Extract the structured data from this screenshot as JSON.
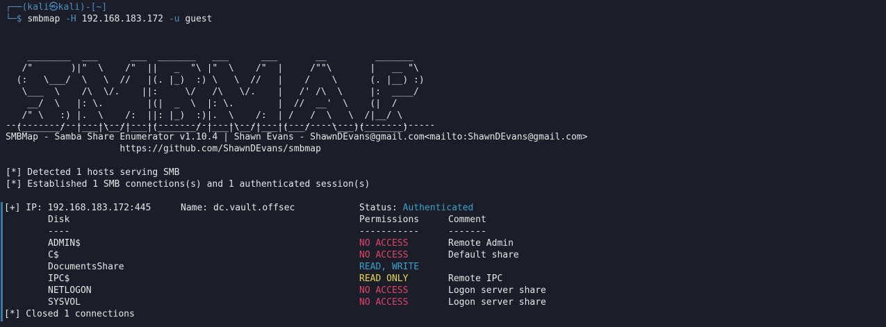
{
  "prompt": {
    "line1": "┌──(kali㉿kali)-[~]",
    "line2_prefix": "└─$ ",
    "command": "smbmap",
    "flag_h": "-H",
    "host": "192.168.183.172",
    "flag_u": "-u",
    "user": "guest"
  },
  "banner": [
    "    ________  ___      ___  _______   ___      ___       __         _______",
    "   /\"       )|\"  \\    /\"  ||   _  \"\\ |\"  \\    /\"  |     /\"\"\\       |   __ \"\\",
    "  (:   \\___/  \\   \\  //   |(. |_)  :) \\   \\  //   |    /    \\      (. |__) :)",
    "   \\___  \\    /\\  \\/.    ||:     \\/   /\\   \\/.    |   /' /\\  \\     |:  ____/",
    "    __/  \\   |: \\.        |(|  _  \\  |: \\.        |  //  __'  \\    (|  /",
    "   /\" \\   :) |.  \\    /:  ||: |_)  :)|.  \\    /:  | /   /  \\   \\  /|__/ \\",
    "  (_______/  |___|\\__/|___|(_______/ |___|\\__/|___|(___/    \\___)(_______)"
  ],
  "rule": "-------------------------------------------------------------------------------",
  "credit_line": "SMBMap - Samba Share Enumerator v1.10.4 | Shawn Evans - ShawnDEvans@gmail.com<mailto:ShawnDEvans@gmail.com>",
  "github_line": "                     https://github.com/ShawnDEvans/smbmap",
  "info": [
    "[*] Detected 1 hosts serving SMB",
    "[*] Established 1 SMB connections(s) and 1 authenticated session(s)"
  ],
  "host_info": {
    "prefix": "[+] IP: 192.168.183.172:445",
    "name": "Name: dc.vault.offsec",
    "status_label": "Status: ",
    "status_value": "Authenticated"
  },
  "table": {
    "col_disk": "Disk",
    "col_perm": "Permissions",
    "col_comment": "Comment",
    "sep_disk": "----",
    "sep_perm": "-----------",
    "sep_comment": "-------",
    "rows": [
      {
        "disk": "ADMIN$",
        "perm": "NO ACCESS",
        "perm_type": "no",
        "comment": "Remote Admin"
      },
      {
        "disk": "C$",
        "perm": "NO ACCESS",
        "perm_type": "no",
        "comment": "Default share"
      },
      {
        "disk": "DocumentsShare",
        "perm": "READ, WRITE",
        "perm_type": "rw",
        "comment": ""
      },
      {
        "disk": "IPC$",
        "perm": "READ ONLY",
        "perm_type": "ro",
        "comment": "Remote IPC"
      },
      {
        "disk": "NETLOGON",
        "perm": "NO ACCESS",
        "perm_type": "no",
        "comment": "Logon server share"
      },
      {
        "disk": "SYSVOL",
        "perm": "NO ACCESS",
        "perm_type": "no",
        "comment": "Logon server share"
      }
    ]
  },
  "closed": "[*] Closed 1 connections",
  "colors": {
    "background": "#1b1e28",
    "prompt_blue": "#4e8fbf",
    "authenticated": "#3aa0c8",
    "no_access": "#e0446a",
    "read_write": "#3aa0c8",
    "read_only": "#e8d84a"
  }
}
